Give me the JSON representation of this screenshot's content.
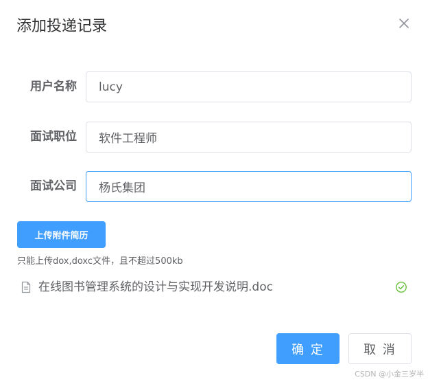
{
  "dialog": {
    "title": "添加投递记录",
    "close_icon": "close-icon"
  },
  "form": {
    "username": {
      "label": "用户名称",
      "value": "lucy"
    },
    "position": {
      "label": "面试职位",
      "value": "软件工程师"
    },
    "company": {
      "label": "面试公司",
      "value": "杨氏集团"
    }
  },
  "upload": {
    "button_label": "上传附件简历",
    "tip": "只能上传dox,doxc文件，且不超过500kb",
    "files": [
      {
        "name": "在线图书管理系统的设计与实现开发说明.doc",
        "status": "success"
      }
    ]
  },
  "footer": {
    "confirm_label": "确 定",
    "cancel_label": "取 消"
  },
  "watermark": "CSDN @小金三岁半",
  "colors": {
    "primary": "#409eff",
    "success": "#67c23a",
    "border": "#dcdfe6"
  }
}
